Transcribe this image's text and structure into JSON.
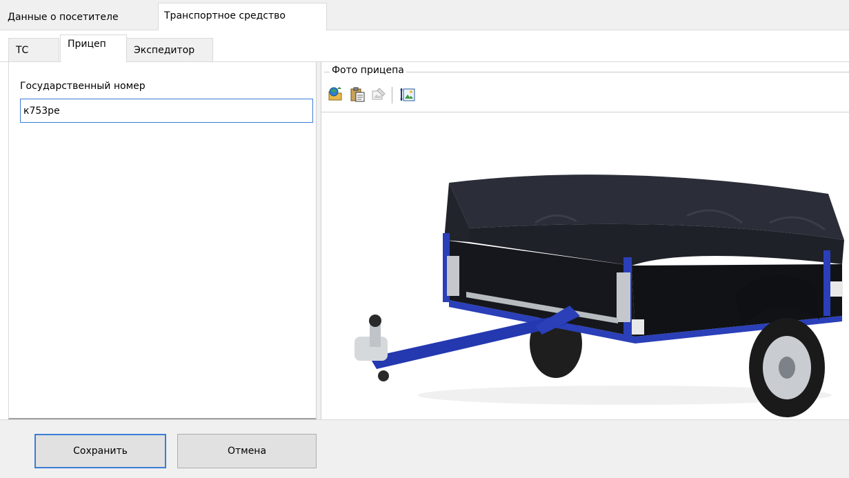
{
  "tabs_top": [
    {
      "label": "Данные о посетителе",
      "active": false
    },
    {
      "label": "Транспортное средство",
      "active": true
    }
  ],
  "tabs_sub": [
    {
      "label": "ТС",
      "active": false
    },
    {
      "label": "Прицеп",
      "active": true
    },
    {
      "label": "Экспедитор",
      "active": false
    }
  ],
  "form": {
    "plate_label": "Государственный номер",
    "plate_value": "к753ре"
  },
  "photo": {
    "group_title": "Фото прицепа",
    "toolbar_icons": [
      "open-image-icon",
      "paste-icon",
      "clear-image-icon",
      "fit-image-icon"
    ],
    "image_alt": "Прицеп с тентом"
  },
  "buttons": {
    "save_label": "Сохранить",
    "cancel_label": "Отмена"
  },
  "colors": {
    "accent": "#3a7cd6",
    "tab_bg": "#f0f0f0",
    "trailer_frame": "#2a3fb8",
    "tarp": "#23262f"
  }
}
